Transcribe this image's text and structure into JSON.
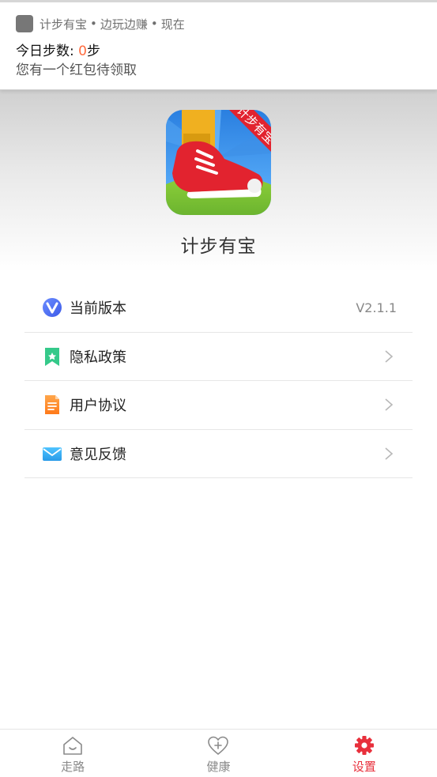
{
  "notification": {
    "app_name": "计步有宝",
    "separator": "•",
    "tagline": "边玩边赚",
    "time": "现在",
    "title_prefix": "今日步数: ",
    "steps": "0",
    "title_suffix": "步",
    "body": "您有一个红包待领取"
  },
  "app": {
    "name": "计步有宝",
    "logo_ribbon_text": "计步有宝"
  },
  "menu": {
    "items": [
      {
        "label": "当前版本",
        "value": "V2.1.1",
        "icon": "version-v-icon"
      },
      {
        "label": "隐私政策",
        "icon": "privacy-bookmark-icon"
      },
      {
        "label": "用户协议",
        "icon": "agreement-document-icon"
      },
      {
        "label": "意见反馈",
        "icon": "feedback-envelope-icon"
      }
    ]
  },
  "tabs": [
    {
      "label": "走路",
      "icon": "home-smile-icon",
      "active": false
    },
    {
      "label": "健康",
      "icon": "heart-plus-icon",
      "active": false
    },
    {
      "label": "设置",
      "icon": "gear-icon",
      "active": true
    }
  ],
  "colors": {
    "accent": "#e8303c",
    "steps_highlight": "#ff6a3d",
    "inactive_tab": "#8a8a8a"
  }
}
